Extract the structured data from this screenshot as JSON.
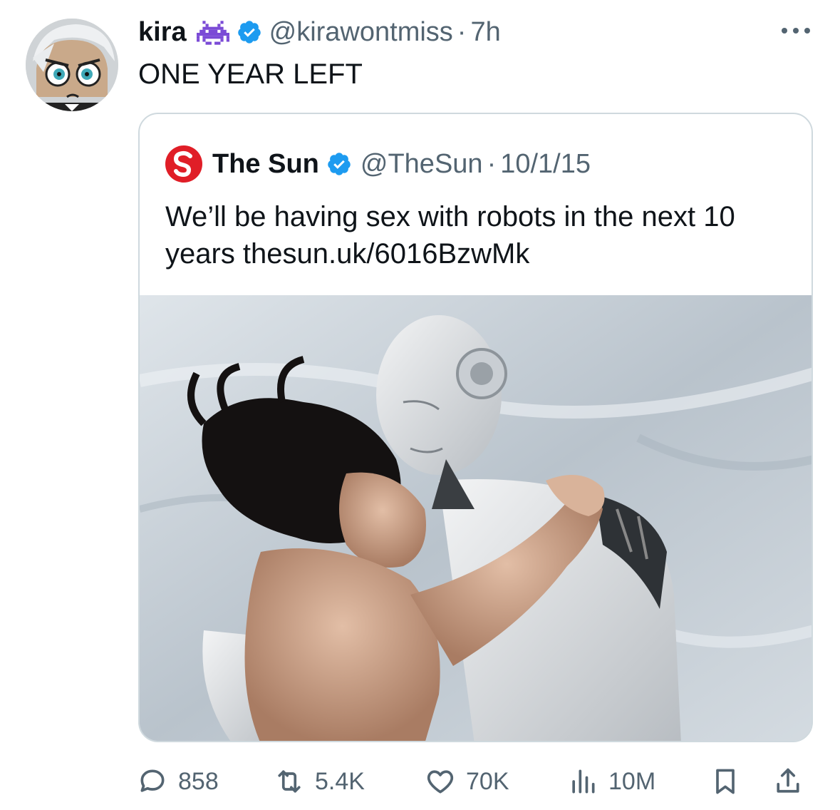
{
  "tweet": {
    "author_name": "kira",
    "handle": "@kirawontmiss",
    "separator": "·",
    "time": "7h",
    "text": "ONE YEAR LEFT",
    "emoji_icon": "space-invader-icon",
    "verified_icon": "verified-icon",
    "more_icon": "more-icon"
  },
  "quote": {
    "author_name": "The Sun",
    "handle": "@TheSun",
    "separator": "·",
    "date": "10/1/15",
    "text": "We’ll be having sex with robots in the next 10 years thesun.uk/6016BzwMk",
    "logo_icon": "sun-logo-icon",
    "image_icon": "robot-embrace-photo"
  },
  "actions": {
    "replies": "858",
    "reposts": "5.4K",
    "likes": "70K",
    "views": "10M"
  },
  "colors": {
    "text": "#0f1419",
    "muted": "#536471",
    "verified": "#1d9bf0",
    "border": "#cfd9de",
    "sun_red": "#e01e27"
  }
}
